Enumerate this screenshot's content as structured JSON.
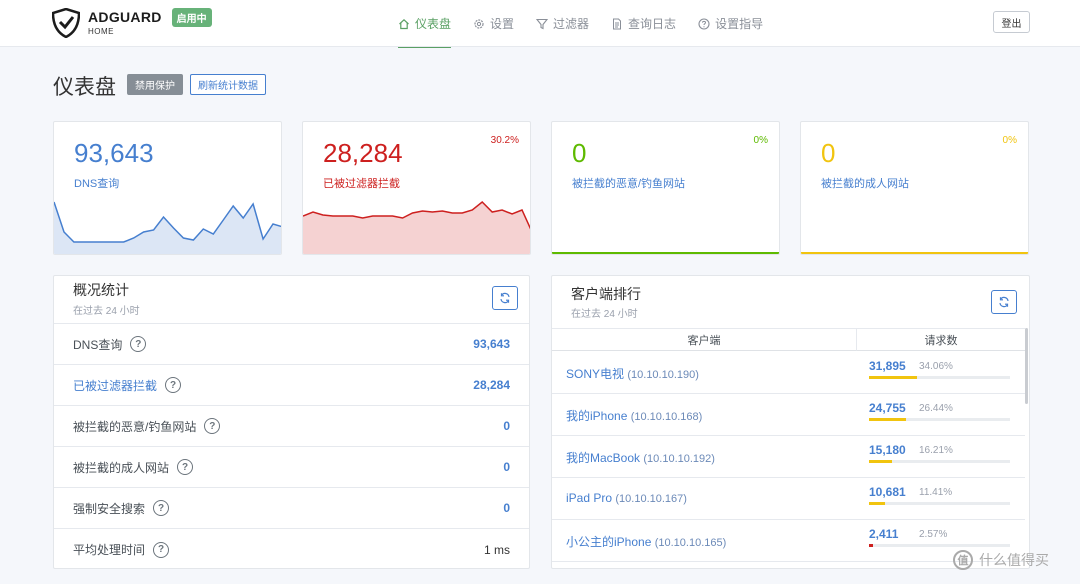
{
  "header": {
    "logo_name": "ADGUARD",
    "logo_sub": "HOME",
    "status_badge": "启用中",
    "nav": [
      {
        "label": "仪表盘",
        "icon": "home-icon",
        "active": true
      },
      {
        "label": "设置",
        "icon": "gear-icon",
        "active": false
      },
      {
        "label": "过滤器",
        "icon": "filter-icon",
        "active": false
      },
      {
        "label": "查询日志",
        "icon": "document-icon",
        "active": false
      },
      {
        "label": "设置指导",
        "icon": "help-circle-icon",
        "active": false
      }
    ],
    "logout_label": "登出"
  },
  "page": {
    "title": "仪表盘",
    "disable_protection_label": "禁用保护",
    "refresh_stats_label": "刷新统计数据"
  },
  "stats": [
    {
      "value": "93,643",
      "label": "DNS查询",
      "pct": "",
      "color": "#467fcf"
    },
    {
      "value": "28,284",
      "label": "已被过滤器拦截",
      "pct": "30.2%",
      "color": "#cd201f"
    },
    {
      "value": "0",
      "label": "被拦截的恶意/钓鱼网站",
      "pct": "0%",
      "color": "#5eba00"
    },
    {
      "value": "0",
      "label": "被拦截的成人网站",
      "pct": "0%",
      "color": "#f1c40f"
    }
  ],
  "sparklines": {
    "dns": [
      52,
      22,
      12,
      12,
      12,
      12,
      12,
      12,
      16,
      22,
      24,
      37,
      26,
      16,
      14,
      25,
      20,
      34,
      48,
      36,
      50,
      15,
      30,
      27
    ],
    "blocked": [
      38,
      42,
      39,
      38,
      38,
      38,
      36,
      38,
      38,
      38,
      36,
      41,
      43,
      42,
      43,
      41,
      41,
      44,
      52,
      42,
      44,
      40,
      44,
      22
    ]
  },
  "overview": {
    "title": "概况统计",
    "subtitle": "在过去 24 小时",
    "rows": [
      {
        "label": "DNS查询",
        "value": "93,643",
        "blue_label": false,
        "dark_value": false
      },
      {
        "label": "已被过滤器拦截",
        "value": "28,284",
        "blue_label": true,
        "dark_value": false
      },
      {
        "label": "被拦截的恶意/钓鱼网站",
        "value": "0",
        "blue_label": false,
        "dark_value": false
      },
      {
        "label": "被拦截的成人网站",
        "value": "0",
        "blue_label": false,
        "dark_value": false
      },
      {
        "label": "强制安全搜索",
        "value": "0",
        "blue_label": false,
        "dark_value": false
      },
      {
        "label": "平均处理时间",
        "value": "1 ms",
        "blue_label": false,
        "dark_value": true
      }
    ]
  },
  "clients": {
    "title": "客户端排行",
    "subtitle": "在过去 24 小时",
    "col_client": "客户端",
    "col_requests": "请求数",
    "rows": [
      {
        "name": "SONY电视",
        "ip": "(10.10.10.190)",
        "count": "31,895",
        "pct": "34.06%",
        "fill": 0.3406,
        "bar_color": "#f1c40f"
      },
      {
        "name": "我的iPhone",
        "ip": "(10.10.10.168)",
        "count": "24,755",
        "pct": "26.44%",
        "fill": 0.2644,
        "bar_color": "#f1c40f"
      },
      {
        "name": "我的MacBook",
        "ip": "(10.10.10.192)",
        "count": "15,180",
        "pct": "16.21%",
        "fill": 0.1621,
        "bar_color": "#f1c40f"
      },
      {
        "name": "iPad Pro",
        "ip": "(10.10.10.167)",
        "count": "10,681",
        "pct": "11.41%",
        "fill": 0.1141,
        "bar_color": "#f1c40f"
      },
      {
        "name": "小公主的iPhone",
        "ip": "(10.10.10.165)",
        "count": "2,411",
        "pct": "2.57%",
        "fill": 0.0257,
        "bar_color": "#cd201f"
      }
    ]
  },
  "help_glyph": "?",
  "watermark": {
    "icon_glyph": "值",
    "text": "什么值得买"
  }
}
